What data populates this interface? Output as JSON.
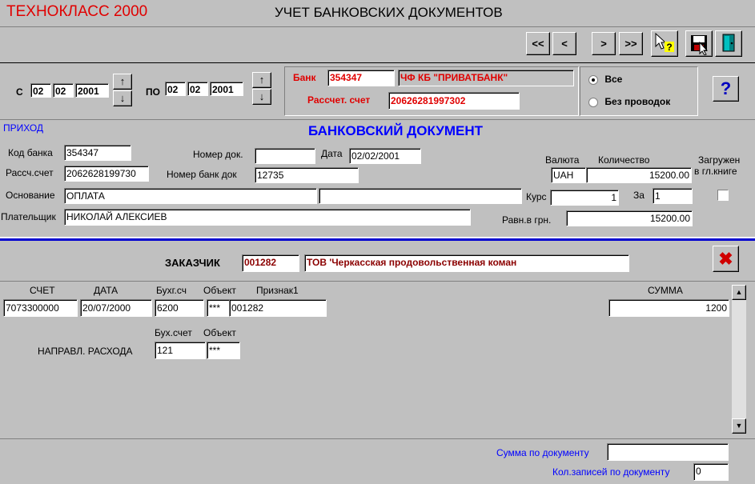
{
  "title_bar": {
    "app_name": "ТЕХНОКЛАСС 2000",
    "window_title": "УЧЕТ БАНКОВСКИХ ДОКУМЕНТОВ"
  },
  "nav": {
    "first": "<<",
    "prev": "<",
    "next": ">",
    "last": ">>"
  },
  "period": {
    "from_label": "С",
    "from_day": "02",
    "from_month": "02",
    "from_year": "2001",
    "to_label": "ПО",
    "to_day": "02",
    "to_month": "02",
    "to_year": "2001"
  },
  "bank": {
    "bank_label": "Банк",
    "bank_code": "354347",
    "bank_name": "ЧФ КБ \"ПРИВАТБАНК\"",
    "account_label": "Рассчет. счет",
    "account": "20626281997302"
  },
  "filter": {
    "all_label": "Все",
    "no_postings_label": "Без проводок",
    "selected": "all"
  },
  "help": "?",
  "doc": {
    "section_label": "ПРИХОД",
    "title": "БАНКОВСКИЙ ДОКУМЕНТ",
    "bank_code_label": "Код банка",
    "bank_code": "354347",
    "doc_number_label": "Номер док.",
    "doc_number": "",
    "date_label": "Дата",
    "date": "02/02/2001",
    "account_label": "Рассч.счет",
    "account": "2062628199730",
    "bank_doc_number_label": "Номер банк док",
    "bank_doc_number": "12735",
    "currency_label": "Валюта",
    "currency": "UAH",
    "quantity_label": "Количество",
    "quantity": "15200.00",
    "loaded_label_1": "Загружен",
    "loaded_label_2": "в гл.книге",
    "basis_label": "Основание",
    "basis": "ОПЛАТА",
    "basis_extra": "",
    "rate_label": "Курс",
    "rate": "1",
    "per_label": "За",
    "per": "1",
    "payer_label": "Плательщик",
    "payer": "НИКОЛАЙ АЛЕКСИЕВ",
    "uah_equiv_label": "Равн.в грн.",
    "uah_equiv": "15200.00"
  },
  "customer": {
    "label": "ЗАКАЗЧИК",
    "code": "001282",
    "name": "ТОВ 'Черкасская продовольственная коман"
  },
  "posting": {
    "headers": {
      "account": "СЧЕТ",
      "date": "ДАТА",
      "ledger": "Бухг.сч",
      "object": "Объект",
      "attr": "Признак1",
      "sum": "СУММА"
    },
    "row": {
      "account": "7073300000",
      "date": "20/07/2000",
      "ledger": "6200",
      "object": "***",
      "attr": "001282",
      "sum": "1200"
    },
    "expense_headers": {
      "ledger": "Бух.счет",
      "object": "Объект"
    },
    "expense_label": "НАПРАВЛ. РАСХОДА",
    "expense_ledger": "121",
    "expense_object": "***"
  },
  "footer": {
    "doc_sum_label": "Сумма по документу",
    "doc_sum": "",
    "records_label": "Кол.записей по документу",
    "records": "0"
  }
}
